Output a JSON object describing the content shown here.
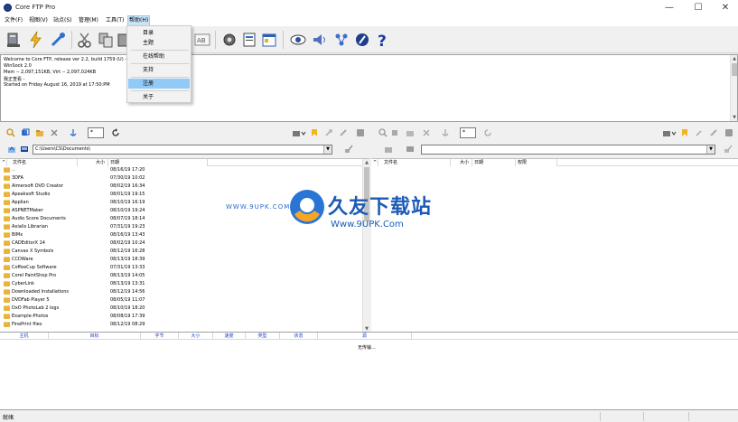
{
  "window": {
    "title": "Core FTP Pro",
    "minimize": "—",
    "maximize": "☐",
    "close": "✕"
  },
  "menu": [
    {
      "label": "文件(F)"
    },
    {
      "label": "视图(V)"
    },
    {
      "label": "站点(S)"
    },
    {
      "label": "管理(M)"
    },
    {
      "label": "工具(T)"
    },
    {
      "label": "帮助(H)"
    }
  ],
  "help_menu": {
    "items": [
      {
        "label": "目录"
      },
      {
        "label": "主题"
      },
      {
        "label": "在线帮助"
      },
      {
        "label": "支持"
      },
      {
        "label": "注册"
      },
      {
        "label": "关于"
      }
    ],
    "highlighted_index": 4
  },
  "log": {
    "lines": [
      "Welcome to Core FTP, release ver 2.2, build 1759 (U) -- ® 2",
      "WinSock 2.0",
      "Mem -- 2,097,151KB, Virt -- 2,097,024KB",
      "我正查看 -",
      "Started on Friday August 16, 2019 at 17:50:PM"
    ]
  },
  "local_pane": {
    "filter_value": "*",
    "path": "C:\\Users\\CS\\Documents\\",
    "columns": [
      "文件名",
      "大小",
      "日期"
    ],
    "files": [
      {
        "name": "..",
        "date": "08/16/19 17:20"
      },
      {
        "name": "3DFA",
        "date": "07/30/19 10:02"
      },
      {
        "name": "Aimersoft DVD Creator",
        "date": "08/02/19 16:34"
      },
      {
        "name": "Apeaksoft Studio",
        "date": "08/01/19 19:15"
      },
      {
        "name": "Applian",
        "date": "08/10/19 16:19"
      },
      {
        "name": "ASPNETMaker",
        "date": "08/10/19 19:24"
      },
      {
        "name": "Audio Score Documents",
        "date": "08/07/19 18:14"
      },
      {
        "name": "Axialis Librarian",
        "date": "07/31/19 19:23"
      },
      {
        "name": "BIMx",
        "date": "08/16/19 13:43"
      },
      {
        "name": "CADEditorX 14",
        "date": "08/02/19 10:24"
      },
      {
        "name": "Canvas X Symbols",
        "date": "08/12/19 16:28"
      },
      {
        "name": "CCDWare",
        "date": "08/13/19 18:39"
      },
      {
        "name": "CoffeeCup Software",
        "date": "07/31/19 13:33"
      },
      {
        "name": "Corel PaintShop Pro",
        "date": "08/13/19 14:05"
      },
      {
        "name": "CyberLink",
        "date": "08/13/19 13:31"
      },
      {
        "name": "Downloaded Installations",
        "date": "08/12/19 14:56"
      },
      {
        "name": "DVDFab Player 5",
        "date": "08/05/19 11:07"
      },
      {
        "name": "DxO PhotoLab 2 logs",
        "date": "08/10/19 18:20"
      },
      {
        "name": "Example-Photos",
        "date": "08/08/19 17:39"
      },
      {
        "name": "FinePrint files",
        "date": "08/12/19 08:29"
      }
    ]
  },
  "remote_pane": {
    "filter_value": "*",
    "path": "",
    "columns": [
      "文件名",
      "大小",
      "日期",
      "权限"
    ]
  },
  "queue": {
    "columns": [
      "主机",
      "目标",
      "字节",
      "大小",
      "速度",
      "类型",
      "状态",
      "源"
    ],
    "message": "无传输..."
  },
  "status": {
    "text": "就绪"
  },
  "watermark": {
    "title": "久友下载站",
    "url": "Www.9UPK.Com",
    "left_text": "WWW.9UPK.COM"
  }
}
